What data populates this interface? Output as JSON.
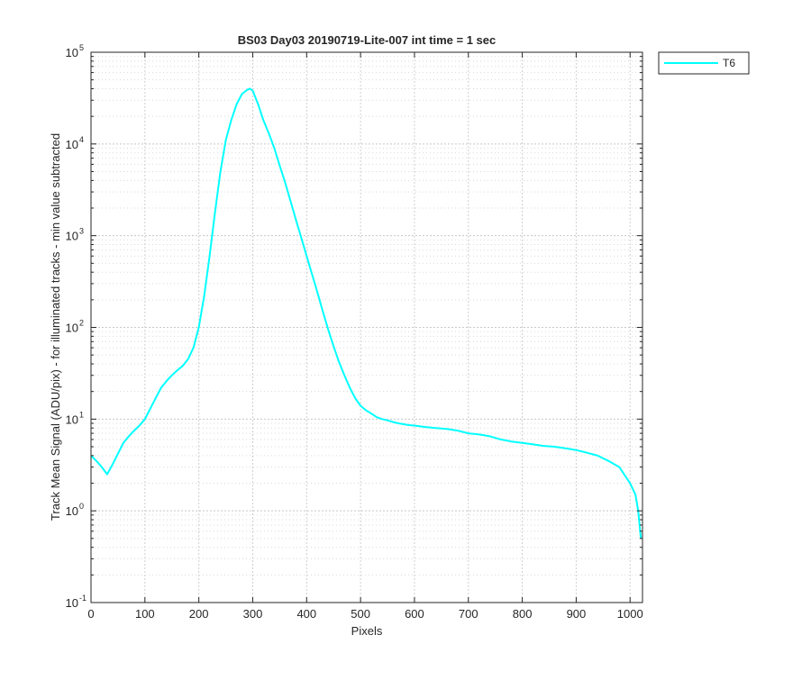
{
  "chart_data": {
    "type": "line",
    "title": "BS03 Day03 20190719-Lite-007 int time = 1 sec",
    "xlabel": "Pixels",
    "ylabel": "Track Mean Signal (ADU/pix) - for illuminated tracks - min value subtracted",
    "x_scale": "linear",
    "y_scale": "log",
    "xlim": [
      0,
      1023
    ],
    "ylim": [
      0.1,
      100000
    ],
    "x_ticks": [
      0,
      100,
      200,
      300,
      400,
      500,
      600,
      700,
      800,
      900,
      1000
    ],
    "x_tick_labels": [
      "0",
      "100",
      "200",
      "300",
      "400",
      "500",
      "600",
      "700",
      "800",
      "900",
      "1000"
    ],
    "y_ticks": [
      0.1,
      1,
      10,
      100,
      1000,
      10000,
      100000
    ],
    "y_tick_labels": [
      {
        "base": "10",
        "exp": "-1"
      },
      {
        "base": "10",
        "exp": "0"
      },
      {
        "base": "10",
        "exp": "1"
      },
      {
        "base": "10",
        "exp": "2"
      },
      {
        "base": "10",
        "exp": "3"
      },
      {
        "base": "10",
        "exp": "4"
      },
      {
        "base": "10",
        "exp": "5"
      }
    ],
    "grid": true,
    "minor_grid": true,
    "legend_position": "outside-top-right",
    "series": [
      {
        "name": "T6",
        "color": "#00FFFF",
        "x": [
          0,
          10,
          20,
          30,
          40,
          50,
          60,
          70,
          80,
          90,
          100,
          110,
          120,
          130,
          140,
          150,
          160,
          170,
          180,
          190,
          200,
          210,
          220,
          230,
          240,
          250,
          260,
          270,
          280,
          290,
          295,
          300,
          310,
          320,
          330,
          340,
          350,
          360,
          370,
          380,
          390,
          400,
          410,
          420,
          430,
          440,
          450,
          460,
          470,
          480,
          490,
          500,
          510,
          520,
          530,
          540,
          550,
          560,
          570,
          580,
          590,
          600,
          620,
          640,
          660,
          680,
          700,
          720,
          740,
          760,
          780,
          800,
          820,
          840,
          860,
          880,
          900,
          920,
          940,
          960,
          980,
          1000,
          1010,
          1015,
          1020
        ],
        "y": [
          4.0,
          3.5,
          3.0,
          2.5,
          3.2,
          4.2,
          5.5,
          6.5,
          7.5,
          8.5,
          10,
          13,
          17,
          22,
          26,
          30,
          34,
          38,
          45,
          60,
          100,
          220,
          600,
          1800,
          5000,
          11000,
          18000,
          27000,
          35000,
          39000,
          40000,
          38000,
          27000,
          18000,
          13000,
          9000,
          5800,
          3800,
          2400,
          1500,
          950,
          600,
          380,
          240,
          150,
          95,
          62,
          42,
          30,
          22,
          17,
          14,
          12.5,
          11.5,
          10.5,
          10,
          9.7,
          9.3,
          9.0,
          8.8,
          8.6,
          8.5,
          8.2,
          8.0,
          7.8,
          7.5,
          7.0,
          6.8,
          6.5,
          6.0,
          5.7,
          5.5,
          5.3,
          5.1,
          5.0,
          4.8,
          4.6,
          4.3,
          4.0,
          3.5,
          3.0,
          2.0,
          1.5,
          1.0,
          0.5
        ]
      }
    ]
  }
}
